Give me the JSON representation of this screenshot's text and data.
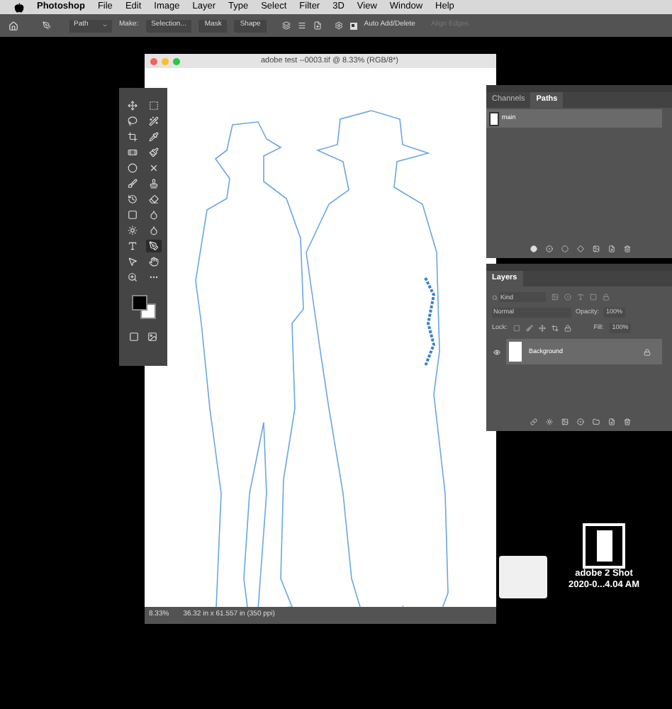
{
  "menu_bar": {
    "items": [
      {
        "label": "Photoshop",
        "bold": true
      },
      {
        "label": "File",
        "bold": false
      },
      {
        "label": "Edit",
        "bold": false
      },
      {
        "label": "Image",
        "bold": false
      },
      {
        "label": "Layer",
        "bold": false
      },
      {
        "label": "Type",
        "bold": false
      },
      {
        "label": "Select",
        "bold": false
      },
      {
        "label": "Filter",
        "bold": false
      },
      {
        "label": "3D",
        "bold": false
      },
      {
        "label": "View",
        "bold": false
      },
      {
        "label": "Window",
        "bold": false
      },
      {
        "label": "Help",
        "bold": false
      }
    ]
  },
  "options_bar": {
    "mode": "Path",
    "make_label": "Make:",
    "buttons": [
      "Selection...",
      "Mask",
      "Shape"
    ],
    "auto_add_delete": {
      "label": "Auto Add/Delete",
      "checked": true
    },
    "align_edges": {
      "label": "Align Edges",
      "disabled": true
    }
  },
  "document": {
    "title": "adobe test --0003.tif @ 8.33% (RGB/8*)",
    "zoom": "8.33%",
    "info": "36.32 in x 61.557 in (350 ppi)"
  },
  "tools": [
    {
      "selected": false
    },
    {
      "selected": false
    },
    {
      "selected": false
    },
    {
      "selected": false
    },
    {
      "selected": false
    },
    {
      "selected": false
    },
    {
      "selected": false
    },
    {
      "selected": false
    },
    {
      "selected": false
    },
    {
      "selected": false
    },
    {
      "selected": false
    },
    {
      "selected": false
    },
    {
      "selected": false
    },
    {
      "selected": false
    },
    {
      "selected": false
    },
    {
      "selected": false
    },
    {
      "selected": false
    },
    {
      "selected": false
    },
    {
      "selected": false
    },
    {
      "selected": true
    },
    {
      "selected": false
    },
    {
      "selected": false
    },
    {
      "selected": false
    },
    {
      "selected": false
    }
  ],
  "paths_panel": {
    "tabs": [
      {
        "label": "Channels",
        "selected": false
      },
      {
        "label": "Paths",
        "selected": true
      }
    ],
    "paths": [
      {
        "name": "main",
        "selected": true
      }
    ]
  },
  "layers_panel": {
    "tabs": [
      {
        "label": "Layers",
        "selected": true
      }
    ],
    "search": {
      "placeholder": "Kind"
    },
    "blend_mode": "Normal",
    "opacity_label": "Opacity:",
    "opacity": "100%",
    "lock_label": "Lock:",
    "fill_label": "Fill:",
    "fill": "100%",
    "layers": [
      {
        "name": "Background",
        "visible": true,
        "locked": true,
        "selected": true
      }
    ]
  },
  "desktop": {
    "items": [
      {
        "kind": "document"
      },
      {
        "kind": "screenshot",
        "lines": [
          "adobe 2 Shot",
          "2020-0...4.04 AM"
        ]
      }
    ]
  }
}
